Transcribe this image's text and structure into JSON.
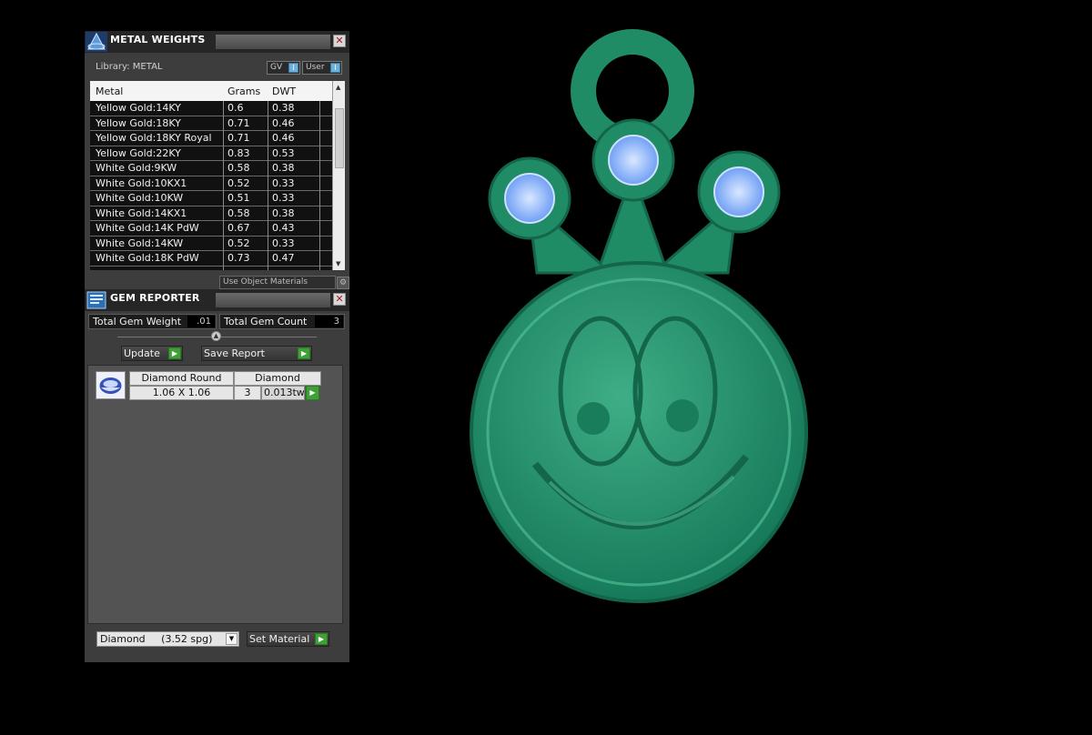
{
  "metal_weights": {
    "title": "METAL WEIGHTS",
    "library_label": "Library: METAL",
    "toggle_gv": "GV",
    "toggle_user": "User",
    "knob_mark": "I",
    "columns": [
      "Metal",
      "Grams",
      "DWT"
    ],
    "rows": [
      [
        "Yellow Gold:14KY",
        "0.6",
        "0.38"
      ],
      [
        "Yellow Gold:18KY",
        "0.71",
        "0.46"
      ],
      [
        "Yellow Gold:18KY Royal",
        "0.71",
        "0.46"
      ],
      [
        "Yellow Gold:22KY",
        "0.83",
        "0.53"
      ],
      [
        "White Gold:9KW",
        "0.58",
        "0.38"
      ],
      [
        "White Gold:10KX1",
        "0.52",
        "0.33"
      ],
      [
        "White Gold:10KW",
        "0.51",
        "0.33"
      ],
      [
        "White Gold:14KX1",
        "0.58",
        "0.38"
      ],
      [
        "White Gold:14K PdW",
        "0.67",
        "0.43"
      ],
      [
        "White Gold:14KW",
        "0.52",
        "0.33"
      ],
      [
        "White Gold:18K PdW",
        "0.73",
        "0.47"
      ]
    ],
    "use_object_materials": "Use Object Materials"
  },
  "gem_reporter": {
    "title": "GEM REPORTER",
    "total_weight_label": "Total Gem Weight",
    "total_weight_value": ".01",
    "total_count_label": "Total Gem Count",
    "total_count_value": "3",
    "update_label": "Update",
    "save_report_label": "Save Report",
    "gem_row": {
      "shape": "Diamond Round",
      "material": "Diamond",
      "size": "1.06 X 1.06",
      "count": "3",
      "weight": "0.013tw"
    },
    "material_select": "Diamond     (3.52 spg)",
    "set_material_label": "Set Material"
  },
  "viewport": {
    "body_color": "#1d8f6a",
    "gem_color": "#8ab8ff"
  }
}
